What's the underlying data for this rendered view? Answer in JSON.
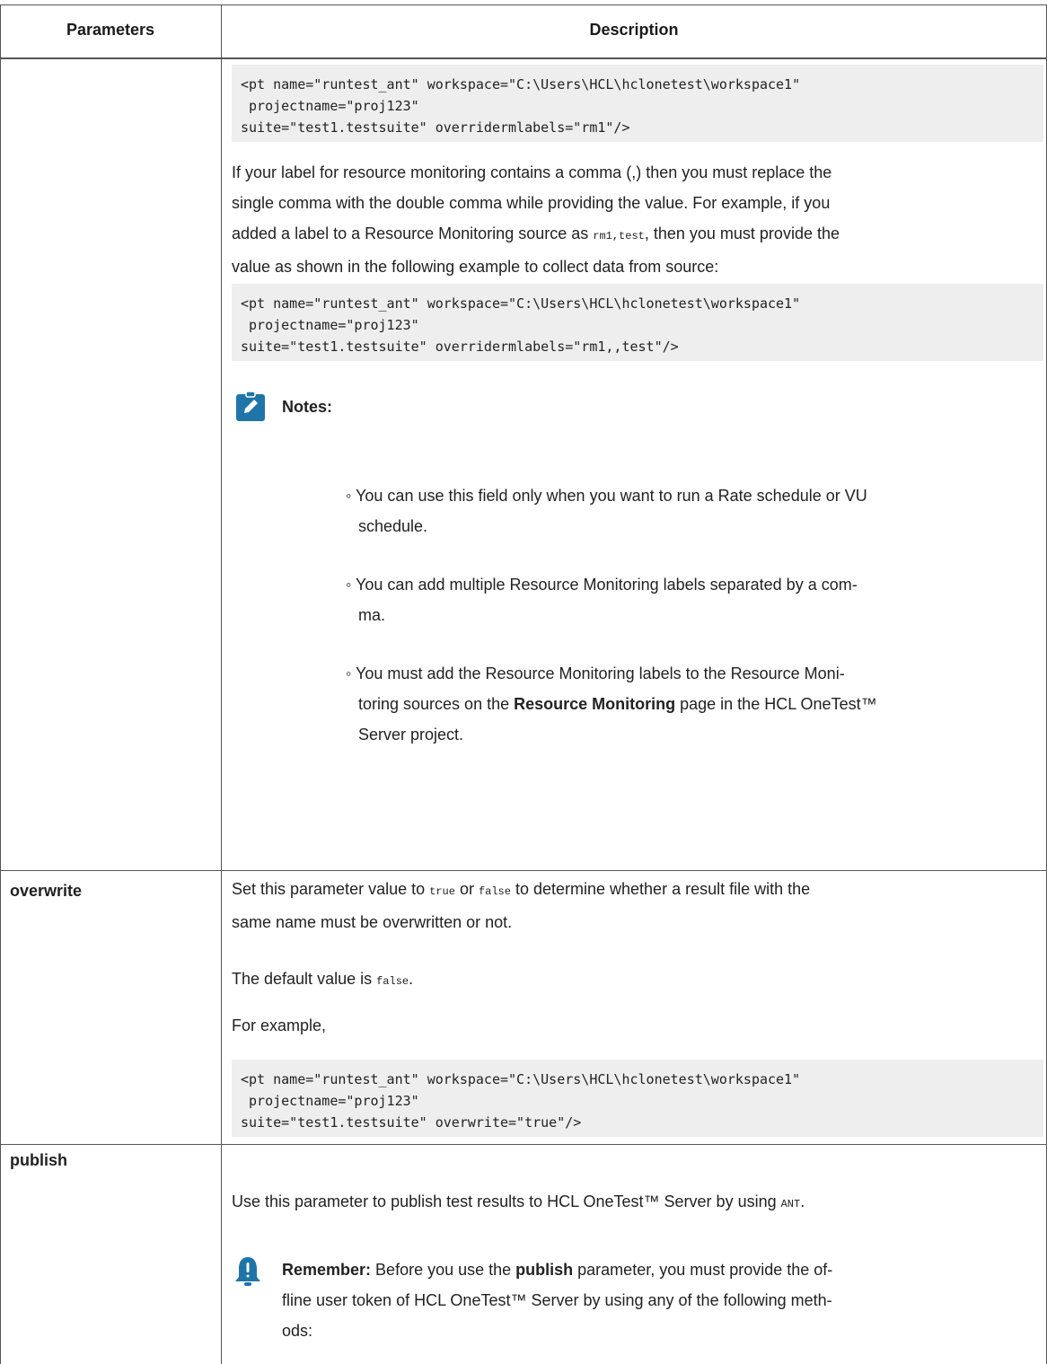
{
  "header": {
    "col1": "Parameters",
    "col2": "Description"
  },
  "code_blocks": {
    "rm_example": [
      "<pt name=\"runtest_ant\" workspace=\"C:\\Users\\HCL\\hclonetest\\workspace1\"",
      " projectname=\"proj123\"",
      "suite=\"test1.testsuite\" overridermlabels=\"rm1\"/>"
    ],
    "rm_comma_example": [
      "<pt name=\"runtest_ant\" workspace=\"C:\\Users\\HCL\\hclonetest\\workspace1\"",
      " projectname=\"proj123\"",
      "suite=\"test1.testsuite\" overridermlabels=\"rm1,,test\"/>"
    ],
    "overwrite_example": [
      "<pt name=\"runtest_ant\" workspace=\"C:\\Users\\HCL\\hclonetest\\workspace1\"",
      " projectname=\"proj123\"",
      "suite=\"test1.testsuite\" overwrite=\"true\"/>"
    ]
  },
  "comma_para": {
    "line1": "If your label for resource monitoring contains a comma (,) then you must replace the",
    "line2": "single comma with the double comma while providing the value. For example, if you",
    "line3_a": "added a label to a Resource Monitoring source as ",
    "line3_code": "rm1,test",
    "line3_b": ", then you must provide the",
    "line4": "value as shown in the following example to collect data from source:"
  },
  "notes": {
    "title": "Notes:",
    "icon": "pencil-note-icon",
    "item1_l1": "◦ You can use this field only when you want to run a Rate schedule or VU",
    "item1_l2": "schedule.",
    "item2_l1": "◦ You can add multiple Resource Monitoring labels separated by a com-",
    "item2_l2": "ma.",
    "item3_l1": "◦ You must add the Resource Monitoring labels to the Resource Moni-",
    "item3_l2_a": "toring sources on the ",
    "item3_l2_bold": "Resource Monitoring",
    "item3_l2_b": " page in the HCL OneTest™",
    "item3_l3": "Server project."
  },
  "overwrite": {
    "name": "overwrite",
    "l1_a": "Set this parameter value to ",
    "l1_code1": "true",
    "l1_mid": " or ",
    "l1_code2": "false",
    "l1_b": " to determine whether a result file with the",
    "l2": "same name must be overwritten or not.",
    "default_a": "The default value is ",
    "default_code": "false",
    "default_b": ".",
    "example": "For example,"
  },
  "publish": {
    "name": "publish",
    "l1_a": "Use this parameter to publish test results to HCL OneTest™ Server by using ",
    "l1_code": "ANT",
    "l1_b": ".",
    "remember_icon": "bell-alert-icon",
    "rem_label": "Remember:",
    "rem_l1_a": " Before you use the ",
    "rem_l1_bold": "publish",
    "rem_l1_b": " parameter, you must provide the of-",
    "rem_l2": "fline user token of HCL OneTest™ Server by using any of the following meth-",
    "rem_l3": "ods:"
  },
  "colors": {
    "accent": "#1f75a8",
    "code_bg": "#eeeeee",
    "border": "#555555"
  }
}
